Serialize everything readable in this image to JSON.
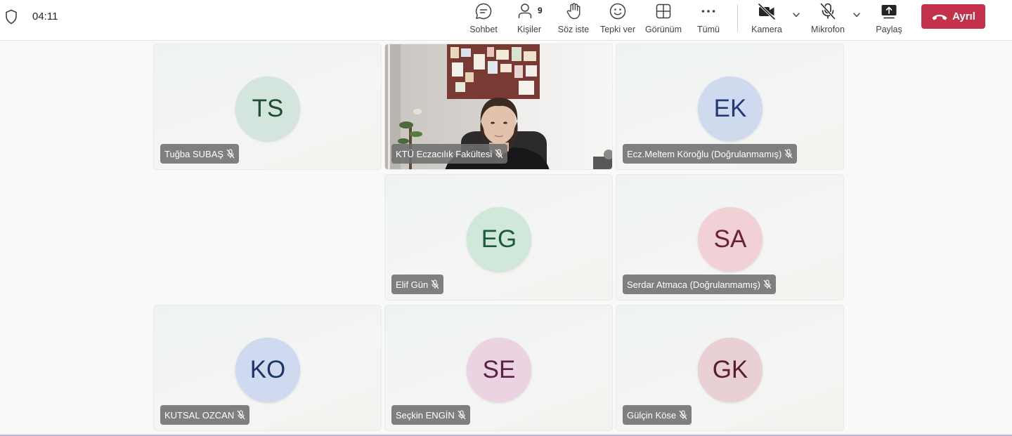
{
  "call": {
    "timer": "04:11"
  },
  "toolbar": {
    "chat_label": "Sohbet",
    "people_label": "Kişiler",
    "people_count": "9",
    "raise_hand_label": "Söz iste",
    "react_label": "Tepki ver",
    "view_label": "Görünüm",
    "more_label": "Tümü",
    "camera_label": "Kamera",
    "mic_label": "Mikrofon",
    "share_label": "Paylaş",
    "leave_label": "Ayrıl"
  },
  "colors": {
    "leave_button": "#c4314b"
  },
  "participants": [
    {
      "initials": "TS",
      "name": "Tuğba SUBAŞ",
      "muted": true,
      "avatar_bg": "#d3e5dc",
      "avatar_fg": "#1f4d37"
    },
    {
      "initials": "",
      "name": "KTÜ Eczacılık Fakültesi",
      "muted": true,
      "video": true
    },
    {
      "initials": "EK",
      "name": "Ecz.Meltem Köroğlu (Doğrulanmamış)",
      "muted": true,
      "avatar_bg": "#cfdaef",
      "avatar_fg": "#243a78"
    },
    {
      "initials": "EG",
      "name": "Elif Gün",
      "muted": true,
      "avatar_bg": "#cfe8d9",
      "avatar_fg": "#1e5a3a"
    },
    {
      "initials": "SA",
      "name": "Serdar Atmaca (Doğrulanmamış)",
      "muted": true,
      "avatar_bg": "#f1d0d6",
      "avatar_fg": "#6b2233"
    },
    {
      "initials": "KO",
      "name": "KUTSAL OZCAN",
      "muted": true,
      "avatar_bg": "#cfd9ef",
      "avatar_fg": "#1f3466"
    },
    {
      "initials": "SE",
      "name": "Seçkin ENGİN",
      "muted": true,
      "avatar_bg": "#ecd3e2",
      "avatar_fg": "#5a2346"
    },
    {
      "initials": "GK",
      "name": "Gülçin Köse",
      "muted": true,
      "avatar_bg": "#e8d0d4",
      "avatar_fg": "#5b1f2b"
    }
  ]
}
